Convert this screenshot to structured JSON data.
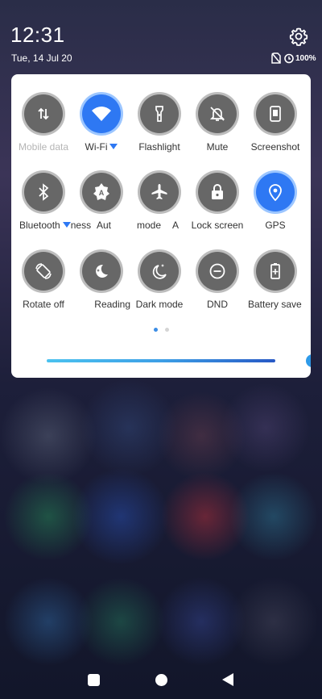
{
  "status_bar": {
    "time": "12:31",
    "date": "Tue, 14 Jul 20",
    "battery_text": "100%",
    "icons": [
      "settings-gear-icon",
      "no-sim-icon",
      "alarm-icon"
    ]
  },
  "quick_settings": {
    "rows": [
      [
        {
          "label": "Mobile data",
          "icon": "mobile-data-arrows-icon",
          "active": false,
          "dimmed": true,
          "has_caret": false
        },
        {
          "label": "Wi-Fi",
          "icon": "wifi-icon",
          "active": true,
          "dimmed": false,
          "has_caret": true
        },
        {
          "label": "Flashlight",
          "icon": "flashlight-icon",
          "active": false,
          "dimmed": false,
          "has_caret": false
        },
        {
          "label": "Mute",
          "icon": "mute-bell-icon",
          "active": false,
          "dimmed": false,
          "has_caret": false
        },
        {
          "label": "Screenshot",
          "icon": "screenshot-phone-icon",
          "active": false,
          "dimmed": false,
          "has_caret": false
        }
      ],
      [
        {
          "label": "Bluetooth",
          "label_tail": "ness",
          "icon": "bluetooth-icon",
          "active": false,
          "dimmed": false,
          "has_caret": true
        },
        {
          "label": "Aut",
          "icon": "auto-brightness-icon",
          "active": false,
          "dimmed": false,
          "has_caret": false
        },
        {
          "label": "mode",
          "label_tail": "A",
          "icon": "airplane-icon",
          "active": false,
          "dimmed": false,
          "has_caret": false
        },
        {
          "label": "Lock screen",
          "icon": "lock-icon",
          "active": false,
          "dimmed": false,
          "has_caret": false
        },
        {
          "label": "GPS",
          "icon": "location-pin-icon",
          "active": true,
          "dimmed": false,
          "has_caret": false
        }
      ],
      [
        {
          "label": "Rotate off",
          "icon": "rotate-icon",
          "active": false,
          "dimmed": false,
          "has_caret": false
        },
        {
          "label": "Reading",
          "icon": "reading-mode-icon",
          "active": false,
          "dimmed": false,
          "has_caret": false
        },
        {
          "label": "Dark mode",
          "icon": "dark-mode-icon",
          "active": false,
          "dimmed": false,
          "has_caret": false
        },
        {
          "label": "DND",
          "icon": "dnd-icon",
          "active": false,
          "dimmed": false,
          "has_caret": false
        },
        {
          "label": "Battery save",
          "icon": "battery-saver-icon",
          "active": false,
          "dimmed": false,
          "has_caret": false
        }
      ]
    ],
    "page_indicator": {
      "pages": 2,
      "current": 1
    },
    "brightness_level": 1.0
  },
  "colors": {
    "active_tile": "#2e78f3",
    "inactive_tile": "#676767",
    "accent": "#3c8de5"
  },
  "navigation_bar": [
    "recents-square-icon",
    "home-circle-icon",
    "back-triangle-icon"
  ]
}
